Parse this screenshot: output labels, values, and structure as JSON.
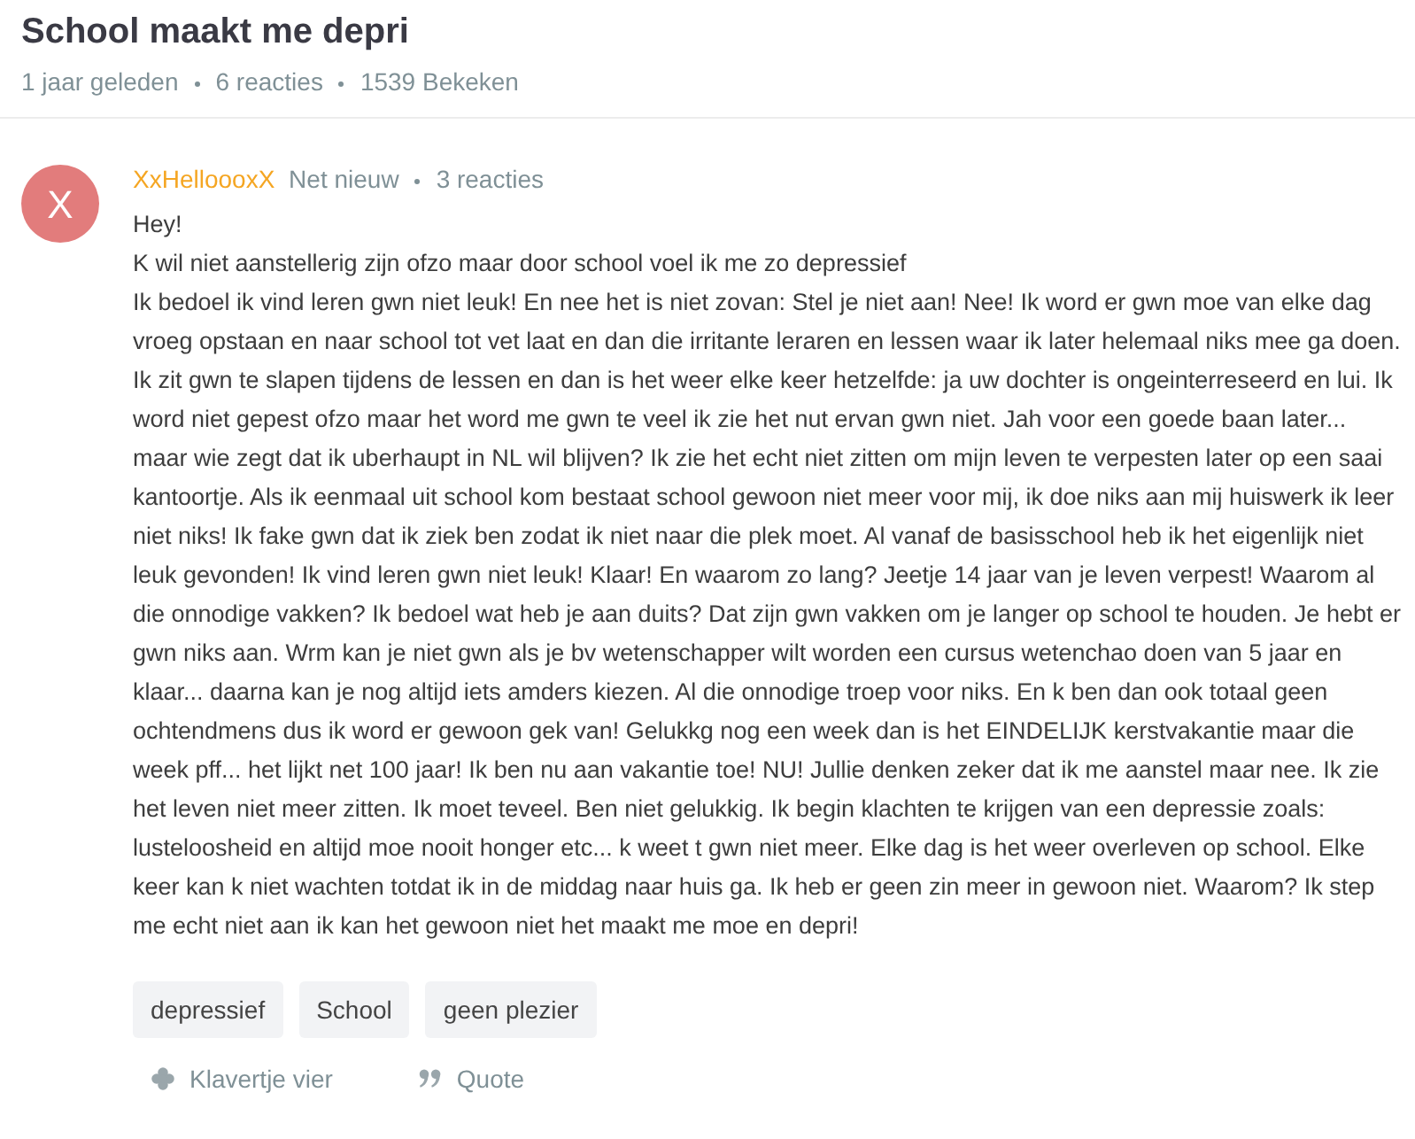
{
  "thread": {
    "title": "School maakt me depri",
    "meta": [
      "1 jaar geleden",
      "6 reacties",
      "1539 Bekeken"
    ]
  },
  "post": {
    "avatar_initial": "X",
    "author": "XxHelloooxX",
    "author_status": "Net nieuw",
    "author_replies": "3 reacties",
    "body": [
      "Hey!",
      "K wil niet aanstellerig zijn ofzo maar door school voel ik me zo depressief",
      "Ik bedoel ik vind leren gwn niet leuk! En nee het is niet zovan: Stel je niet aan! Nee! Ik word er gwn moe van elke dag vroeg opstaan en naar school tot vet laat en dan die irritante leraren en lessen waar ik later helemaal niks mee ga doen. Ik zit gwn te slapen tijdens de lessen en dan is het weer elke keer hetzelfde: ja uw dochter is ongeinterreseerd en lui. Ik word niet gepest ofzo maar het word me gwn te veel ik zie het nut ervan gwn niet. Jah voor een goede baan later... maar wie zegt dat ik uberhaupt in NL wil blijven? Ik zie het echt niet zitten om mijn leven te verpesten later op een saai kantoortje. Als ik eenmaal uit school kom bestaat school gewoon niet meer voor mij, ik doe niks aan mij huiswerk ik leer niet niks! Ik fake gwn dat ik ziek ben zodat ik niet naar die plek moet. Al vanaf de basisschool heb ik het eigenlijk niet leuk gevonden! Ik vind leren gwn niet leuk! Klaar! En waarom zo lang? Jeetje 14 jaar van je leven verpest! Waarom al die onnodige vakken? Ik bedoel wat heb je aan duits? Dat zijn gwn vakken om je langer op school te houden. Je hebt er gwn niks aan. Wrm kan je niet gwn als je bv wetenschapper wilt worden een cursus wetenchao doen van 5 jaar en klaar... daarna kan je nog altijd iets amders kiezen. Al die onnodige troep voor niks. En k ben dan ook totaal geen ochtendmens dus ik word er gewoon gek van! Gelukkg nog een week dan is het EINDELIJK kerstvakantie maar die week pff... het lijkt net 100 jaar! Ik ben nu aan vakantie toe! NU! Jullie denken zeker dat ik me aanstel maar nee. Ik zie het leven niet meer zitten. Ik moet teveel. Ben niet gelukkig. Ik begin klachten te krijgen van een depressie zoals: lusteloosheid en altijd moe nooit honger etc... k weet t gwn niet meer. Elke dag is het weer overleven op school. Elke keer kan k niet wachten totdat ik in de middag naar huis ga. Ik heb er geen zin meer in gewoon niet. Waarom? Ik step me echt niet aan ik kan het gewoon niet het maakt me moe en depri!"
    ],
    "tags": [
      "depressief",
      "School",
      "geen plezier"
    ],
    "actions": [
      {
        "kind": "clover",
        "label": "Klavertje vier"
      },
      {
        "kind": "quote",
        "label": "Quote"
      }
    ]
  }
}
